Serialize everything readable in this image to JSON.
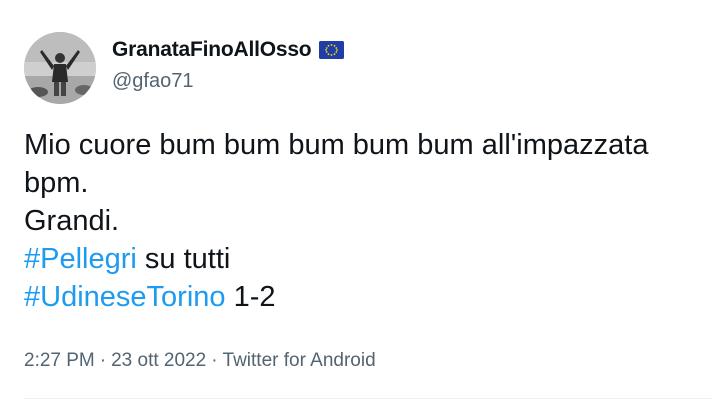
{
  "author": {
    "display_name": "GranataFinoAllOsso",
    "handle": "@gfao71",
    "badge_icon": "eu-flag-icon",
    "badge_color": "#1f3ea8"
  },
  "tweet": {
    "line1": "Mio cuore bum bum bum bum bum all'impazzata",
    "line2": "bpm.",
    "line3": "Grandi.",
    "line4_hashtag": "#Pellegri",
    "line4_text": " su tutti",
    "line5_hashtag": "#UdineseTorino",
    "line5_text": " 1-2"
  },
  "meta": {
    "time": "2:27 PM",
    "sep1": "·",
    "date": "23 ott 2022",
    "sep2": "·",
    "source": "Twitter for Android"
  },
  "colors": {
    "link": "#1d9bf0",
    "secondary_text": "#536471",
    "primary_text": "#0f1419"
  }
}
